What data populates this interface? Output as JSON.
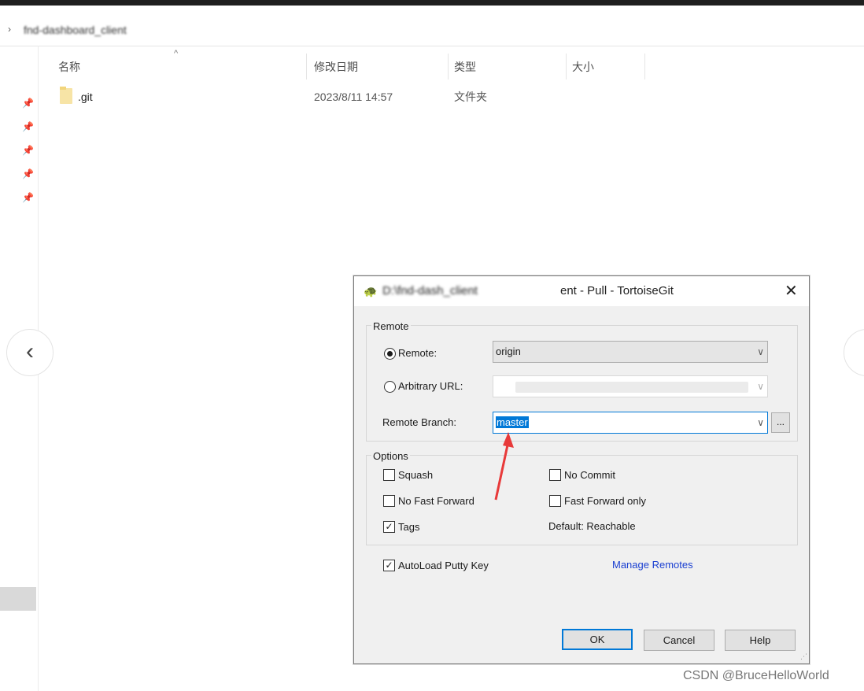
{
  "explorer": {
    "breadcrumb_chevron": "›",
    "path": "fnd-dashboard_client",
    "columns": {
      "name": "名称",
      "modified": "修改日期",
      "type": "类型",
      "size": "大小"
    },
    "sort_arrow": "^",
    "rows": [
      {
        "name": ".git",
        "modified": "2023/8/11 14:57",
        "type": "文件夹",
        "size": ""
      }
    ],
    "pin_glyph": "📌",
    "nav_prev": "‹",
    "nav_next": "›"
  },
  "dialog": {
    "title_blurred": "D:\\fnd-dash_client",
    "title": "ent - Pull - TortoiseGit",
    "close": "✕",
    "remote_group": {
      "label": "Remote",
      "remote_label": "Remote:",
      "remote_value": "origin",
      "remote_selected": true,
      "arbitrary_label": "Arbitrary URL:",
      "arbitrary_value": "",
      "branch_label": "Remote Branch:",
      "branch_value": "master",
      "browse_label": "..."
    },
    "options_group": {
      "label": "Options",
      "squash": {
        "label": "Squash",
        "checked": false
      },
      "no_commit": {
        "label": "No Commit",
        "checked": false
      },
      "no_fast_forward": {
        "label": "No Fast Forward",
        "checked": false
      },
      "fast_forward_only": {
        "label": "Fast Forward only",
        "checked": false
      },
      "tags": {
        "label": "Tags",
        "checked": true
      },
      "default_text": "Default: Reachable"
    },
    "autoload": {
      "label": "AutoLoad Putty Key",
      "checked": true
    },
    "manage_remotes": "Manage Remotes",
    "buttons": {
      "ok": "OK",
      "cancel": "Cancel",
      "help": "Help"
    },
    "check_glyph": "✓",
    "dropdown_glyph": "∨",
    "grip_glyph": "⋰"
  },
  "annotation": {
    "arrow_color": "#e83a3a"
  },
  "watermark": "CSDN @BruceHelloWorld"
}
